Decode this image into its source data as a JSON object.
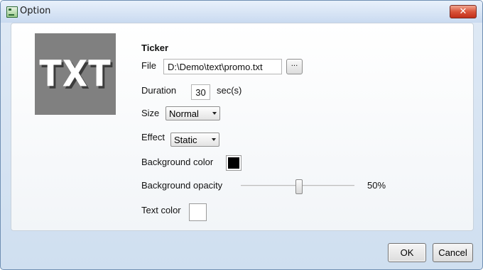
{
  "window": {
    "title": "Option",
    "close_symbol": "✕"
  },
  "preview": {
    "text": "TXT"
  },
  "form": {
    "heading": "Ticker",
    "file_label": "File",
    "file_value": "D:\\Demo\\text\\promo.txt",
    "browse_label": "...",
    "duration_label": "Duration",
    "duration_value": "30",
    "duration_unit": "sec(s)",
    "size_label": "Size",
    "size_value": "Normal",
    "effect_label": "Effect",
    "effect_value": "Static",
    "bg_color_label": "Background color",
    "bg_color": "#000000",
    "bg_opacity_label": "Background opacity",
    "bg_opacity_value": 50,
    "bg_opacity_text": "50%",
    "text_color_label": "Text color",
    "text_color": "#ffffff"
  },
  "buttons": {
    "ok_label": "OK",
    "cancel_label": "Cancel"
  }
}
